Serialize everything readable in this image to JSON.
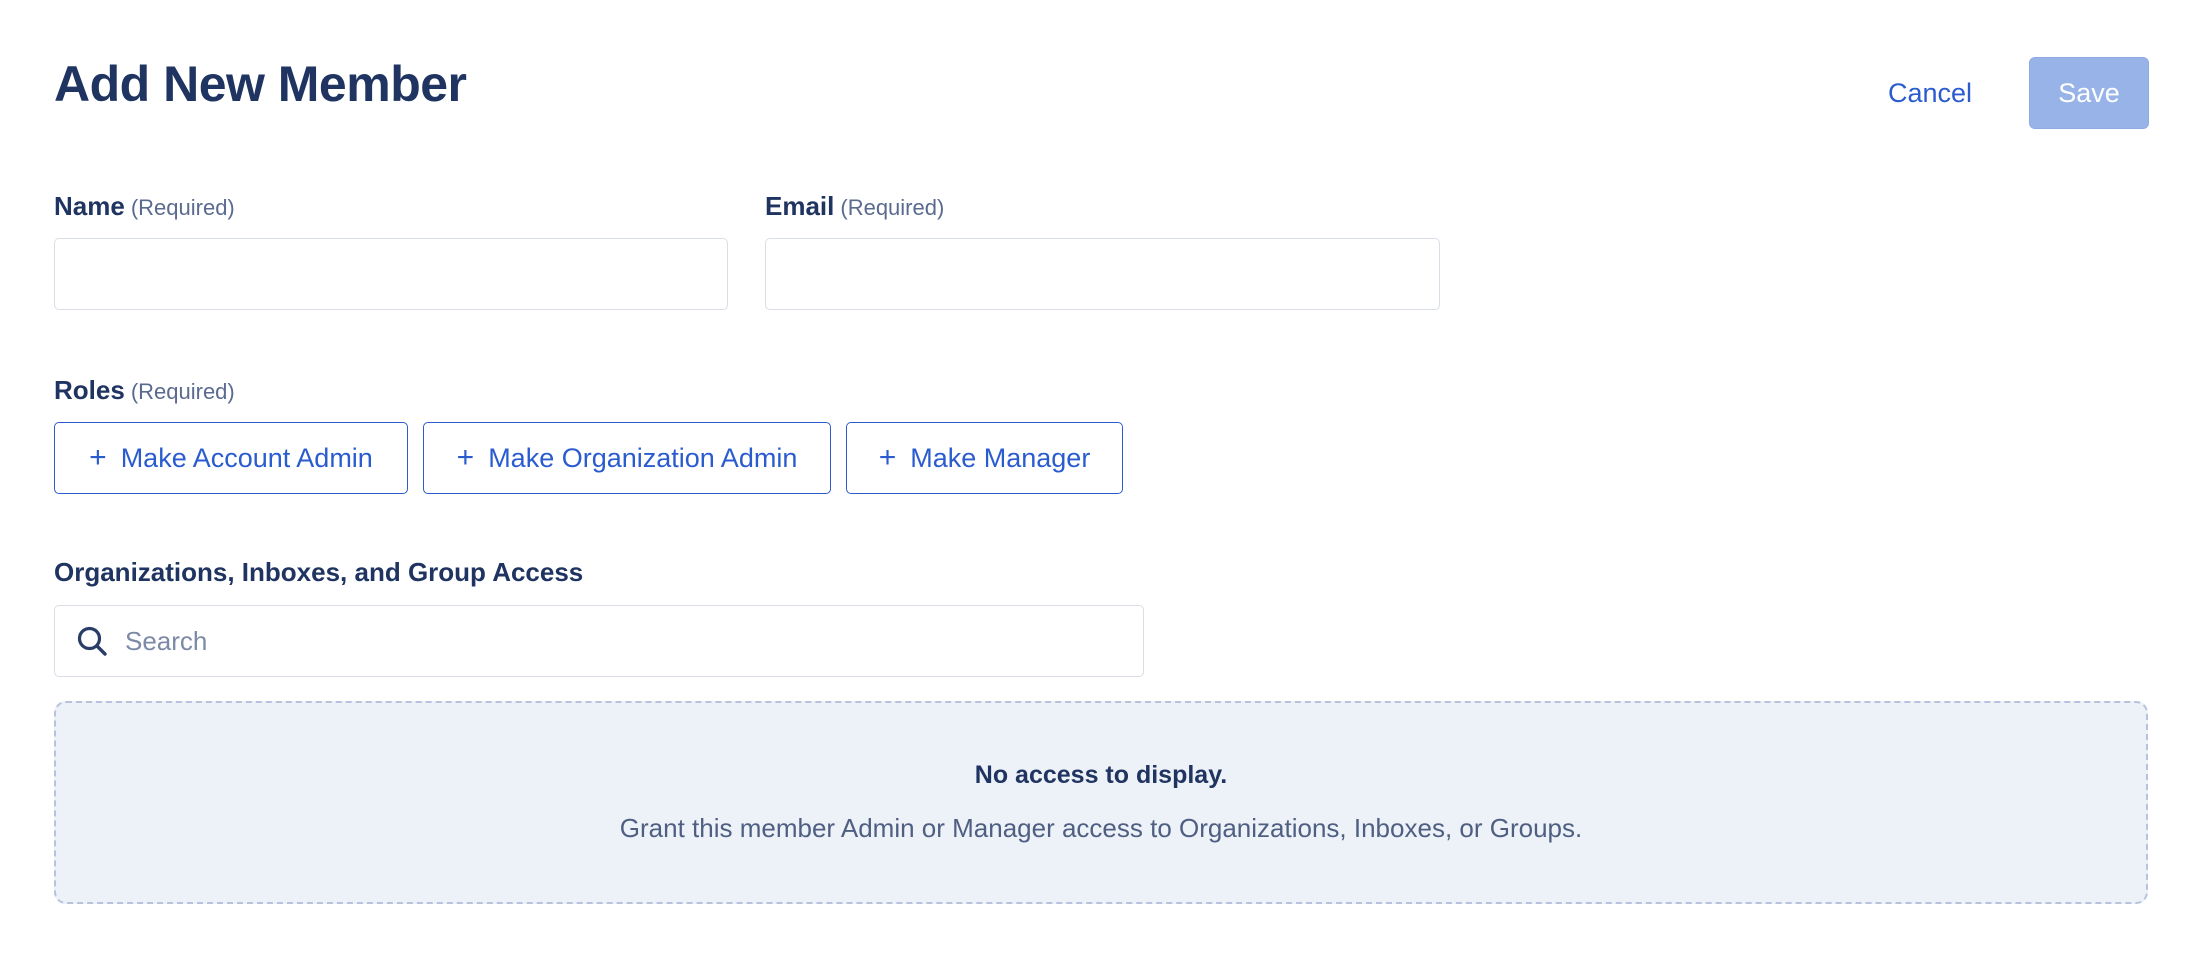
{
  "header": {
    "title": "Add New Member",
    "cancel_label": "Cancel",
    "save_label": "Save"
  },
  "form": {
    "name": {
      "label": "Name",
      "required_hint": "(Required)",
      "value": ""
    },
    "email": {
      "label": "Email",
      "required_hint": "(Required)",
      "value": ""
    },
    "roles": {
      "label": "Roles",
      "required_hint": "(Required)",
      "buttons": [
        {
          "label": "Make Account Admin",
          "icon": "plus-icon"
        },
        {
          "label": "Make Organization Admin",
          "icon": "plus-icon"
        },
        {
          "label": "Make Manager",
          "icon": "plus-icon"
        }
      ]
    },
    "access": {
      "label": "Organizations, Inboxes, and Group Access",
      "search_placeholder": "Search",
      "search_icon": "search-icon",
      "empty_title": "No access to display.",
      "empty_description": "Grant this member Admin or Manager access to Organizations, Inboxes, or Groups."
    }
  },
  "colors": {
    "heading": "#1f3460",
    "accent": "#2a5ccf",
    "save_disabled_bg": "#98b3e8",
    "empty_bg": "#edf1f8",
    "empty_border": "#b8c2dd"
  }
}
